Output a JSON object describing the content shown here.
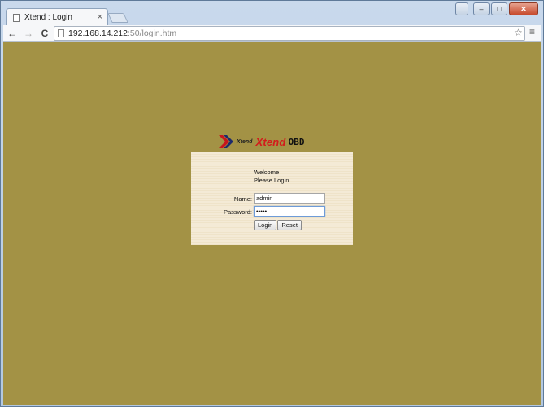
{
  "browser": {
    "tab_title": "Xtend : Login",
    "tab_close": "×",
    "url_host": "192.168.14.212",
    "url_rest": ":50/login.htm",
    "back_glyph": "←",
    "forward_glyph": "→",
    "reload_glyph": "C",
    "star_glyph": "☆",
    "menu_glyph": "≡"
  },
  "window_controls": {
    "minimize": "–",
    "maximize": "□",
    "close": "✕"
  },
  "logo": {
    "small_brand": "Xtend",
    "big_brand": "Xtend",
    "suffix": "OBD"
  },
  "login": {
    "welcome": "Welcome",
    "please_login": "Please Login...",
    "name_label": "Name:",
    "name_value": "admin",
    "password_label": "Password:",
    "password_value": "admin",
    "login_button": "Login",
    "reset_button": "Reset"
  },
  "colors": {
    "page_bg": "#a39245",
    "panel_bg": "#f4ead6",
    "brand_red": "#d21c1c"
  },
  "icons": [
    "document-icon",
    "close-icon",
    "back-arrow-icon",
    "forward-arrow-icon",
    "reload-icon",
    "star-icon",
    "menu-icon",
    "xtend-chevron-icon"
  ]
}
